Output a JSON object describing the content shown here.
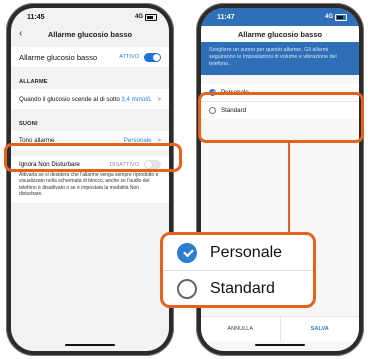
{
  "left_phone": {
    "time": "11:45",
    "signal": "4G",
    "title": "Allarme glucosio basso",
    "alarm_row": {
      "label": "Allarme glucosio basso",
      "state": "ATTIVO"
    },
    "section_alarms": "ALLARME",
    "threshold_row": {
      "label": "Quando il glucosio scende al di sotto",
      "value": "3,4 mmol/L",
      "chevron": ">"
    },
    "section_sounds": "SUONI",
    "tone_row": {
      "label": "Tono allarme",
      "value": "Personale",
      "chevron": ">"
    },
    "dnd_row": {
      "label": "Ignora Non Disturbare",
      "state": "DISATTIVO",
      "description": "Attivarla se si desidera che l'allarme venga sempre riprodotto e visualizzato nella schermata di blocco, anche se l'audio del telefono è disattivato o se è impostata la modalità Non disturbare."
    }
  },
  "right_phone": {
    "time": "11:47",
    "signal": "4G",
    "title": "Allarme glucosio basso",
    "info": "Scegliere un suono per questo allarme. Gli allarmi seguiranno le impostazioni di volume e vibrazione del telefono.",
    "options": [
      {
        "label": "Personale",
        "selected": true
      },
      {
        "label": "Standard",
        "selected": false
      }
    ],
    "cancel_label": "ANNULLA",
    "save_label": "SALVA"
  },
  "zoom": {
    "options": [
      {
        "label": "Personale",
        "selected": true
      },
      {
        "label": "Standard",
        "selected": false
      }
    ]
  },
  "colors": {
    "accent": "#2e7dd1",
    "highlight": "#e4621f",
    "header": "#2f6fb8"
  },
  "icons": [
    "back-chevron-icon",
    "toggle-switch-icon",
    "radio-checked-icon",
    "radio-empty-icon",
    "battery-icon"
  ]
}
